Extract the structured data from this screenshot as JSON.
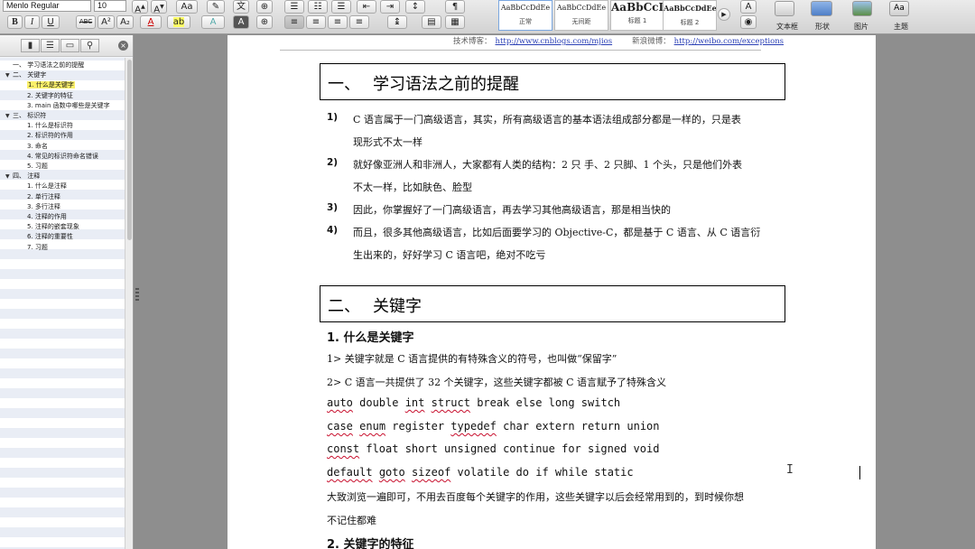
{
  "ribbon": {
    "font_name": "Menlo Regular",
    "font_size": "10",
    "format_buttons": [
      "B",
      "I",
      "U",
      "ABC",
      "A²",
      "A₂"
    ],
    "styles": [
      {
        "sample": "AaBbCcDdEe",
        "name": "正常",
        "selected": true
      },
      {
        "sample": "AaBbCcDdEe",
        "name": "无间距",
        "selected": false
      },
      {
        "sample": "AaBbCcD",
        "name": "标题 1",
        "selected": false
      },
      {
        "sample": "AaBbCcDdEe",
        "name": "标题 2",
        "selected": false
      }
    ],
    "insert_groups": [
      {
        "icon": "text-box-icon",
        "label": "文本框"
      },
      {
        "icon": "shape-icon",
        "label": "形状"
      },
      {
        "icon": "picture-icon",
        "label": "图片"
      },
      {
        "icon": "theme-icon",
        "label": "主题"
      }
    ],
    "theme_sample": "Aa"
  },
  "sidebar": {
    "close_symbol": "×",
    "outline": [
      {
        "level": 1,
        "toggle": "",
        "text": "一、  学习语法之前的提醒"
      },
      {
        "level": 1,
        "toggle": "▼",
        "text": "二、  关键字"
      },
      {
        "level": 2,
        "toggle": "",
        "text": "1. 什么是关键字",
        "active": true
      },
      {
        "level": 2,
        "toggle": "",
        "text": "2. 关键字的特征"
      },
      {
        "level": 2,
        "toggle": "",
        "text": "3. main 函数中哪些是关键字"
      },
      {
        "level": 1,
        "toggle": "▼",
        "text": "三、  标识符"
      },
      {
        "level": 2,
        "toggle": "",
        "text": "1. 什么是标识符"
      },
      {
        "level": 2,
        "toggle": "",
        "text": "2. 标识符的作用"
      },
      {
        "level": 2,
        "toggle": "",
        "text": "3. 命名"
      },
      {
        "level": 2,
        "toggle": "",
        "text": "4. 常见的标识符命名错误"
      },
      {
        "level": 2,
        "toggle": "",
        "text": "5. 习题"
      },
      {
        "level": 1,
        "toggle": "▼",
        "text": "四、  注释"
      },
      {
        "level": 2,
        "toggle": "",
        "text": "1. 什么是注释"
      },
      {
        "level": 2,
        "toggle": "",
        "text": "2. 单行注释"
      },
      {
        "level": 2,
        "toggle": "",
        "text": "3. 多行注释"
      },
      {
        "level": 2,
        "toggle": "",
        "text": "4. 注释的作用"
      },
      {
        "level": 2,
        "toggle": "",
        "text": "5. 注释的嵌套现象"
      },
      {
        "level": 2,
        "toggle": "",
        "text": "6. 注释的重要性"
      },
      {
        "level": 2,
        "toggle": "",
        "text": "7. 习题"
      }
    ]
  },
  "document": {
    "header": {
      "blog_label": "技术博客：",
      "blog_url": "http://www.cnblogs.com/mjios",
      "weibo_label": "新浪微博：",
      "weibo_url": "http://weibo.com/exceptions"
    },
    "section1": {
      "number": "一、",
      "title": "学习语法之前的提醒",
      "items": [
        {
          "num": "1)",
          "lines": [
            "C 语言属于一门高级语言，其实，所有高级语言的基本语法组成部分都是一样的，只是表",
            "现形式不太一样"
          ]
        },
        {
          "num": "2)",
          "lines": [
            "就好像亚洲人和非洲人，大家都有人类的结构：2 只 手、2 只脚、1 个头，只是他们外表",
            "不太一样，比如肤色、脸型"
          ]
        },
        {
          "num": "3)",
          "lines": [
            "因此，你掌握好了一门高级语言，再去学习其他高级语言，那是相当快的"
          ]
        },
        {
          "num": "4)",
          "lines": [
            "而且，很多其他高级语言，比如后面要学习的 Objective-C，都是基于 C 语言、从 C 语言衍",
            "生出来的，好好学习 C 语言吧，绝对不吃亏"
          ]
        }
      ]
    },
    "section2": {
      "number": "二、",
      "title": "关键字",
      "sub1": "1.  什么是关键字",
      "p1": "1>  关键字就是 C 语言提供的有特殊含义的符号，也叫做“保留字”",
      "p2": "2>  C 语言一共提供了 32 个关键字，这些关键字都被 C 语言赋予了特殊含义",
      "code_lines": [
        [
          {
            "t": "auto",
            "sq": true
          },
          {
            "t": " double "
          },
          {
            "t": "int",
            "sq": true
          },
          {
            "t": " "
          },
          {
            "t": "struct",
            "sq": true
          },
          {
            "t": " break else long switch"
          }
        ],
        [
          {
            "t": "case",
            "sq": true
          },
          {
            "t": " "
          },
          {
            "t": "enum",
            "sq": true
          },
          {
            "t": " register "
          },
          {
            "t": "typedef",
            "sq": true
          },
          {
            "t": " char extern return union"
          }
        ],
        [
          {
            "t": "const",
            "sq": true
          },
          {
            "t": " float short unsigned continue for signed void"
          }
        ],
        [
          {
            "t": "default",
            "sq": true
          },
          {
            "t": " "
          },
          {
            "t": "goto",
            "sq": true
          },
          {
            "t": " "
          },
          {
            "t": "sizeof",
            "sq": true
          },
          {
            "t": " volatile do if while static"
          }
        ]
      ],
      "p3_lines": [
        "大致浏览一遍即可，不用去百度每个关键字的作用，这些关键字以后会经常用到的，到时候你想",
        "不记住都难"
      ],
      "sub2": "2.  关键字的特征"
    }
  }
}
